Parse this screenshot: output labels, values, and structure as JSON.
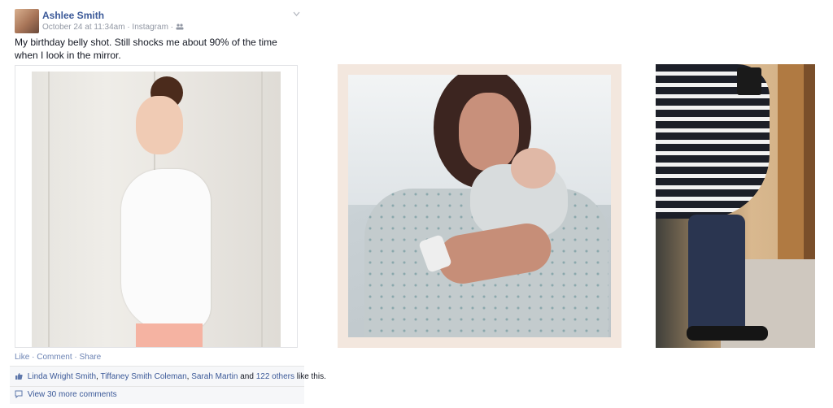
{
  "post": {
    "author": "Ashlee Smith",
    "meta": "October 24 at 11:34am · Instagram ·",
    "text": "My birthday belly shot. Still shocks me about 90% of the time when I look in the mirror.",
    "actions": {
      "like": "Like",
      "comment": "Comment",
      "share": "Share",
      "sep": " · "
    },
    "likes": {
      "names": [
        "Linda Wright Smith",
        "Tiffaney Smith Coleman",
        "Sarah Martin"
      ],
      "and_text": " and ",
      "others": "122 others",
      "suffix": " like this."
    },
    "comments_link": "View 30 more comments",
    "icons": [
      "people-icon",
      "chevron-down-icon",
      "thumbs-up-icon",
      "comment-icon"
    ]
  }
}
